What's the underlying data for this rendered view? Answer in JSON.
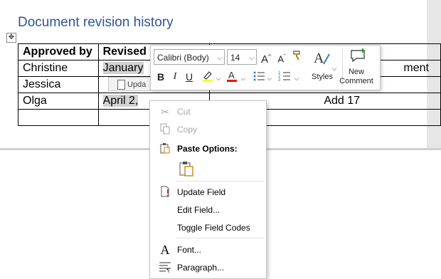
{
  "document": {
    "title": "Document revision history",
    "table": {
      "headers": [
        "Approved by",
        "Revised",
        "",
        ""
      ],
      "rows": [
        [
          "Christine",
          "January",
          "",
          "ment"
        ],
        [
          "Jessica",
          "",
          "",
          ""
        ],
        [
          "Olga",
          "April 2, ",
          "",
          "Add  17"
        ],
        [
          "",
          "",
          "",
          ""
        ]
      ]
    },
    "field_tag": "Upda"
  },
  "mini_toolbar": {
    "font_name": "Calibri (Body)",
    "font_size": "14",
    "styles_label": "Styles",
    "new_comment_label": "New Comment",
    "highlight_color": "#ffff00",
    "font_color": "#ff0000"
  },
  "context_menu": {
    "cut": "Cut",
    "copy": "Copy",
    "paste_options": "Paste Options:",
    "update_field": "Update Field",
    "edit_field": "Edit Field...",
    "toggle_field_codes": "Toggle Field Codes",
    "font": "Font...",
    "paragraph": "Paragraph..."
  },
  "colors": {
    "title": "#2e5597",
    "field_shade": "#d2d2d2",
    "disabled_text": "#a6a6a6"
  }
}
